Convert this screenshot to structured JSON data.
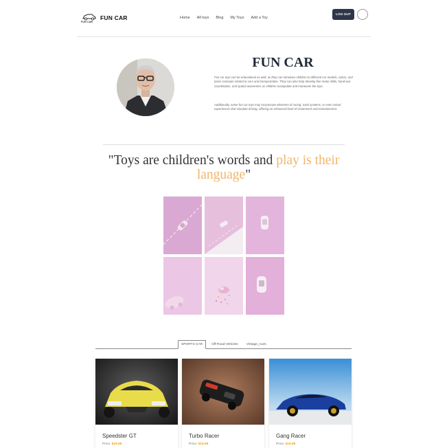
{
  "nav": {
    "logo_small": "FUN CAR",
    "brand": "FUN CAR",
    "links": [
      "Home",
      "All toys",
      "Blog",
      "My Toys",
      "Add a Toy"
    ],
    "logout_label": "LOG OUT"
  },
  "about": {
    "title": "FUN CAR",
    "p1": "Fun car toys can be educational as well, as they can introduce children to different car models, colors, and basic concepts related to cars and transportation. They can also help develop fine motor skills, hand-eye coordination, and spatial awareness as children manipulate and maneuver the toys.",
    "p2": "Additionally, some fun car toys may incorporate elements of racing, track systems, or even virtual experiences that simulate driving, offering an enhanced level of excitement and entertainment."
  },
  "quote": {
    "part1": "\"Toys are children's words and ",
    "highlight": "play is their language",
    "part2": "\""
  },
  "tabs": [
    "SPORTS CAR",
    "Off-Road Vehicles",
    "Vintage_Cars"
  ],
  "cards": [
    {
      "name": "Speedster GT",
      "price_label": "Price: ",
      "price": "$29.99"
    },
    {
      "name": "Turbo Racer",
      "price_label": "Price: ",
      "price": "$19.99"
    },
    {
      "name": "Gang Racer",
      "price_label": "Price: ",
      "price": "$19.99"
    }
  ],
  "colors": {
    "accent": "#f0b56b",
    "button": "#2d3748",
    "price": "#f59e0b",
    "tile_pink": "#e3b8dc"
  }
}
